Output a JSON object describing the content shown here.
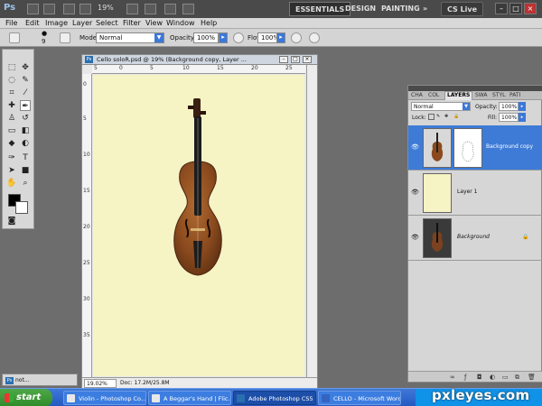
{
  "app": {
    "logo": "Ps",
    "zoom": "19%",
    "workspaces": [
      "ESSENTIALS",
      "DESIGN",
      "PAINTING"
    ],
    "more": "»",
    "cs_live": "CS Live",
    "window_controls": [
      "–",
      "□",
      "×"
    ]
  },
  "menu": [
    "File",
    "Edit",
    "Image",
    "Layer",
    "Select",
    "Filter",
    "View",
    "Window",
    "Help"
  ],
  "options": {
    "brush_size": "9",
    "mode_label": "Mode:",
    "mode_value": "Normal",
    "opacity_label": "Opacity:",
    "opacity_value": "100%",
    "flow_label": "Flow:",
    "flow_value": "100%"
  },
  "document": {
    "title": "Cello soloR.psd @ 19% (Background copy, Layer ...",
    "ruler_top": [
      "5",
      "0",
      "5",
      "10",
      "15",
      "20",
      "25"
    ],
    "ruler_left": [
      "0",
      "5",
      "10",
      "15",
      "20",
      "25",
      "30",
      "35"
    ],
    "zoom": "19.02%",
    "info": "Doc: 17.2M/25.8M",
    "controls": [
      "–",
      "□",
      "×"
    ]
  },
  "layers_panel": {
    "tabs": [
      "CHA",
      "COL",
      "LAYERS",
      "SWA",
      "STYL",
      "PATI"
    ],
    "blend_mode": "Normal",
    "opacity_label": "Opacity:",
    "opacity_value": "100%",
    "lock_label": "Lock:",
    "fill_label": "Fill:",
    "fill_value": "100%",
    "layers": [
      {
        "name": "Background copy",
        "selected": true
      },
      {
        "name": "Layer 1",
        "selected": false
      },
      {
        "name": "Background",
        "selected": false
      }
    ],
    "footer_icons": [
      "link-icon",
      "fx-icon",
      "mask-icon",
      "adjustment-icon",
      "group-icon",
      "new-layer-icon",
      "trash-icon"
    ]
  },
  "minimized_doc": "not...",
  "taskbar": {
    "start": "start",
    "items": [
      {
        "label": "Violin - Photoshop Co...",
        "active": false
      },
      {
        "label": "A Beggar's Hand | Flic...",
        "active": false
      },
      {
        "label": "Adobe Photoshop CS5",
        "active": true
      },
      {
        "label": "CELLO - Microsoft Word",
        "active": false
      }
    ],
    "watermark": "pxleyes.com"
  },
  "colors": {
    "canvas_bg": "#f6f3c4",
    "selected_layer": "#3d7bd7",
    "taskbar": "#245ac2",
    "violin": "#8a4a1e"
  }
}
